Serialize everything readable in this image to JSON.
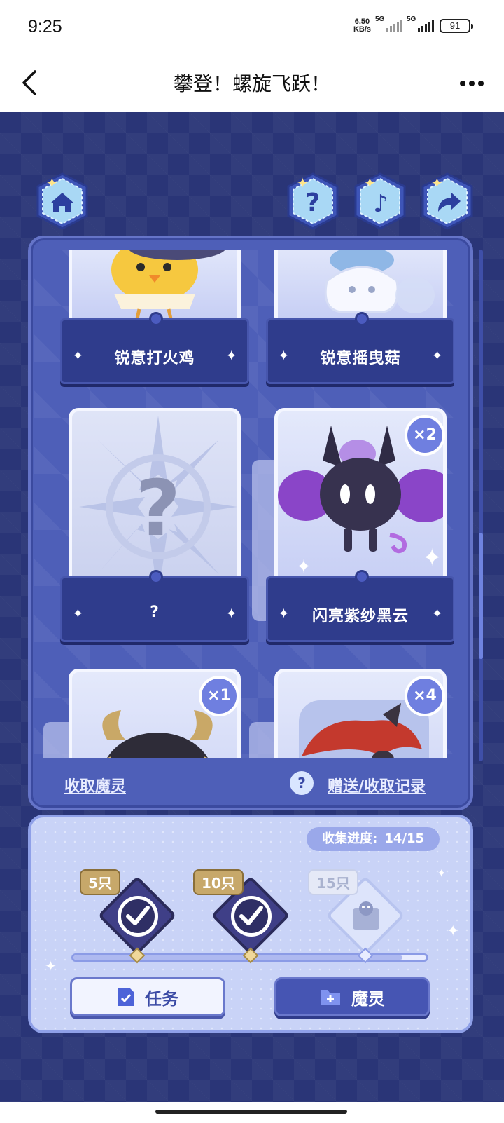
{
  "status_bar": {
    "time": "9:25",
    "net_speed_value": "6.50",
    "net_speed_unit": "KB/s",
    "signal1_label": "5G",
    "signal2_label": "5G",
    "battery": "91"
  },
  "nav": {
    "title": "攀登！螺旋飞跃！",
    "back_icon": "chevron-left-icon",
    "more_icon": "more-dots-icon"
  },
  "toolbar": {
    "home_icon": "home-icon",
    "help_icon": "question-icon",
    "music_icon": "music-note-icon",
    "share_icon": "share-arrow-icon"
  },
  "cards": [
    {
      "name": "锐意打火鸡",
      "badge": ""
    },
    {
      "name": "锐意摇曳菇",
      "badge": ""
    },
    {
      "name": "?",
      "badge": ""
    },
    {
      "name": "闪亮紫纱黑云",
      "badge": "×2"
    },
    {
      "name": "",
      "badge": "×1"
    },
    {
      "name": "",
      "badge": "×4"
    }
  ],
  "panel_footer": {
    "collect_label": "收取魔灵",
    "help_symbol": "?",
    "record_label": "赠送/收取记录"
  },
  "progress": {
    "label": "收集进度:",
    "value": "14/15",
    "collected": 14,
    "total": 15,
    "milestones": [
      {
        "label": "5只",
        "done": true
      },
      {
        "label": "10只",
        "done": true
      },
      {
        "label": "15只",
        "done": false
      }
    ]
  },
  "buttons": {
    "task_label": "任务",
    "spirit_label": "魔灵"
  },
  "colors": {
    "background": "#2a3577",
    "panel": "#4e5fb8",
    "accent": "#6f7fe0",
    "bottom_panel": "#c9d3f7"
  }
}
